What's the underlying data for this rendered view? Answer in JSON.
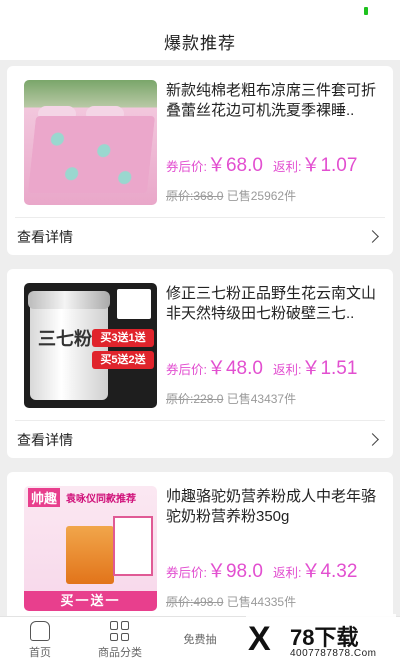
{
  "header": {
    "title": "爆款推荐"
  },
  "labels": {
    "after_price": "券后价:",
    "rebate": "返利:",
    "view_detail": "查看详情",
    "sold_prefix": "已售"
  },
  "products": [
    {
      "name": "新款纯棉老粗布凉席三件套可折叠蕾丝花边可机洗夏季裸睡..",
      "price": "￥68.0",
      "rebate": "￥1.07",
      "original_label": "原价:",
      "original": "368.0",
      "sold": "25962件",
      "image": "bed-sheet-image"
    },
    {
      "name": "修正三七粉正品野生花云南文山非天然特级田七粉破壁三七..",
      "price": "￥48.0",
      "rebate": "￥1.51",
      "original_label": "原价:",
      "original": "228.0",
      "sold": "43437件",
      "image": "sanqi-powder-image",
      "image_text": {
        "jar": "三七粉",
        "tag1": "买3送1送",
        "tag2": "买5送2送"
      }
    },
    {
      "name": "帅趣骆驼奶营养粉成人中老年骆驼奶粉营养粉350g",
      "price": "￥98.0",
      "rebate": "￥4.32",
      "original_label": "原价:",
      "original": "498.0",
      "sold": "44335件",
      "image": "camel-milk-image",
      "image_text": {
        "brand": "帅趣",
        "head": "袁咏仪同款推荐",
        "bottom": "买一送一"
      }
    }
  ],
  "tabbar": {
    "home": "首页",
    "category": "商品分类",
    "lottery": "免费抽"
  },
  "watermark": {
    "brand": "78下载",
    "url": "4007787878.Com"
  }
}
